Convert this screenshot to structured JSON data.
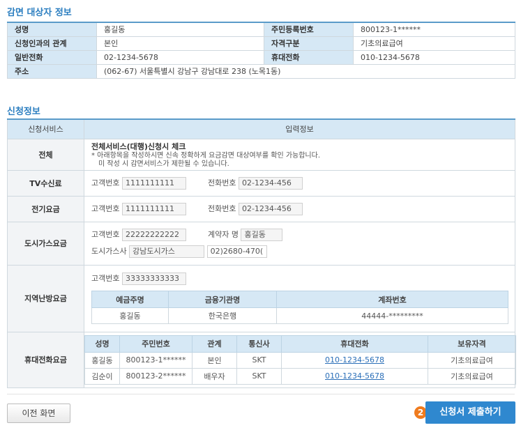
{
  "section1_title": "감면 대상자 정보",
  "info": {
    "name_label": "성명",
    "name": "홍길동",
    "rrn_label": "주민등록번호",
    "rrn": "800123-1******",
    "relation_label": "신청인과의 관계",
    "relation": "본인",
    "qualification_label": "자격구분",
    "qualification": "기초의료급여",
    "phone_label": "일반전화",
    "phone": "02-1234-5678",
    "mobile_label": "휴대전화",
    "mobile": "010-1234-5678",
    "address_label": "주소",
    "address": "(062-67) 서울특별시 강남구 강남대로 238 (노목1동)"
  },
  "section2_title": "신청정보",
  "apply": {
    "col_service": "신청서비스",
    "col_input": "입력정보",
    "all_label": "전체",
    "all_title": "전체서비스(대행)신청시 체크",
    "all_desc1": "* 아래항목을 작성하시면 신속 정확하게 요금감면 대상여부를 확인 가능합니다.",
    "all_desc2": "미 작성 시 감면서비스가 제한될 수 있습니다.",
    "tv_label": "TV수신료",
    "tv_cust_label": "고객번호",
    "tv_cust": "1111111111",
    "tv_tel_label": "전화번호",
    "tv_tel": "02-1234-456",
    "elec_label": "전기요금",
    "elec_cust_label": "고객번호",
    "elec_cust": "1111111111",
    "elec_tel_label": "전화번호",
    "elec_tel": "02-1234-456",
    "gas_label": "도시가스요금",
    "gas_cust_label": "고객번호",
    "gas_cust": "22222222222",
    "gas_holder_label": "계약자 명",
    "gas_holder": "홍길동",
    "gas_company_label": "도시가스사",
    "gas_company": "강남도시가스",
    "gas_company_tel": "02)2680-470(",
    "heat_label": "지역난방요금",
    "heat_cust_label": "고객번호",
    "heat_cust": "33333333333",
    "heat_cols": [
      "예금주명",
      "금융기관명",
      "계좌번호"
    ],
    "heat_row": [
      "홍길동",
      "한국은행",
      "44444-*********"
    ],
    "mobile_label": "휴대전화요금",
    "mobile_cols": [
      "성명",
      "주민번호",
      "관계",
      "통신사",
      "휴대전화",
      "보유자격"
    ],
    "mobile_rows": [
      [
        "홍길동",
        "800123-1******",
        "본인",
        "SKT",
        "010-1234-5678",
        "기초의료급여"
      ],
      [
        "김순이",
        "800123-2******",
        "배우자",
        "SKT",
        "010-1234-5678",
        "기초의료급여"
      ]
    ]
  },
  "buttons": {
    "prev": "이전 화면",
    "submit": "신청서 제출하기",
    "step": "2"
  },
  "colors": {
    "accent": "#2b7ec0",
    "header_bg": "#d6e8f5",
    "submit_bg": "#2f88cf",
    "badge": "#ef7b1e"
  }
}
